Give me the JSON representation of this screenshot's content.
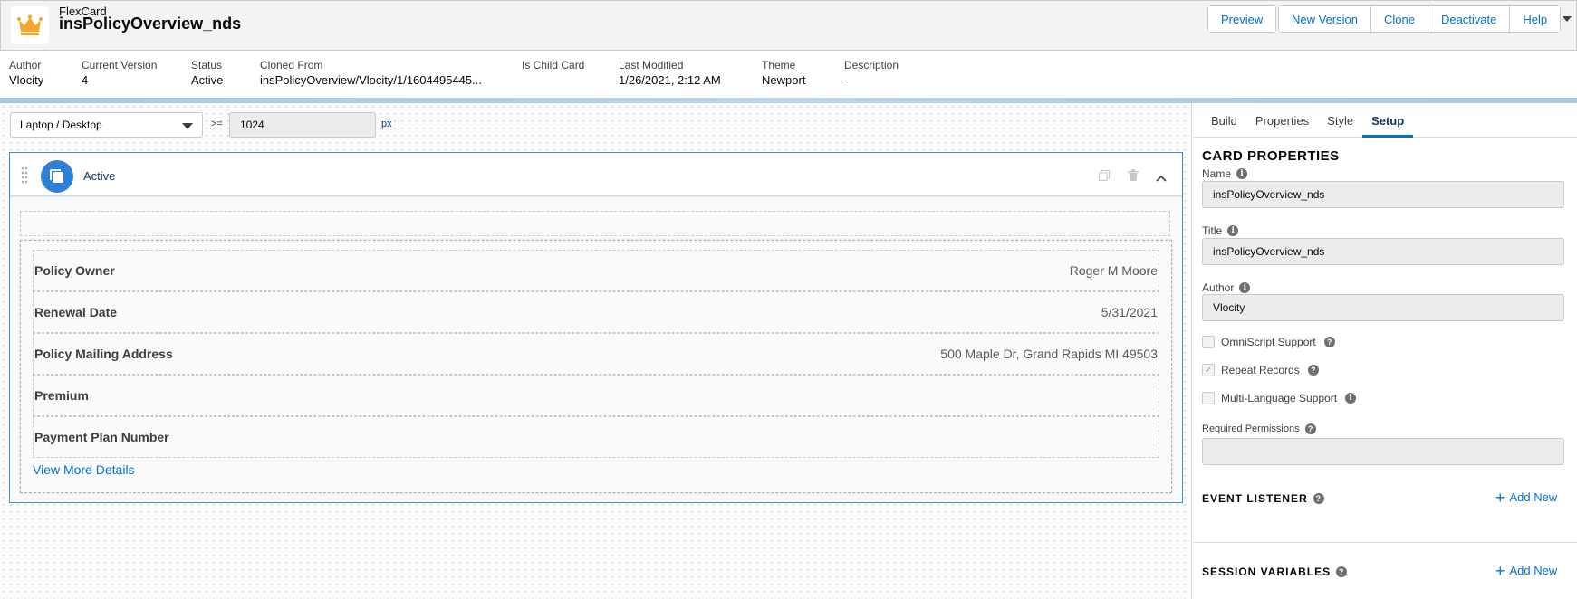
{
  "header": {
    "subtitle": "FlexCard",
    "title": "insPolicyOverview_nds",
    "buttons": [
      "Preview",
      "New Version",
      "Clone",
      "Deactivate",
      "Help"
    ]
  },
  "meta": [
    {
      "label": "Author",
      "value": "Vlocity"
    },
    {
      "label": "Current Version",
      "value": "4"
    },
    {
      "label": "Status",
      "value": "Active"
    },
    {
      "label": "Cloned From",
      "value": "insPolicyOverview/Vlocity/1/1604495445..."
    },
    {
      "label": "Is Child Card",
      "value": ""
    },
    {
      "label": "Last Modified",
      "value": "1/26/2021, 2:12 AM"
    },
    {
      "label": "Theme",
      "value": "Newport"
    },
    {
      "label": "Description",
      "value": "-"
    }
  ],
  "canvas": {
    "device": "Laptop / Desktop",
    "gte": ">=",
    "width_value": "1024",
    "unit": "px",
    "state_label": "Active",
    "fields": [
      {
        "label": "Policy Owner",
        "value": "Roger M Moore"
      },
      {
        "label": "Renewal Date",
        "value": "5/31/2021"
      },
      {
        "label": "Policy Mailing Address",
        "value": "500 Maple Dr, Grand Rapids MI 49503"
      },
      {
        "label": "Premium",
        "value": ""
      },
      {
        "label": "Payment Plan Number",
        "value": ""
      }
    ],
    "view_more": "View More Details"
  },
  "panel": {
    "tabs": [
      "Build",
      "Properties",
      "Style",
      "Setup"
    ],
    "active_tab": "Setup",
    "section_title": "CARD PROPERTIES",
    "name_label": "Name",
    "name_value": "insPolicyOverview_nds",
    "title_label": "Title",
    "title_value": "insPolicyOverview_nds",
    "author_label": "Author",
    "author_value": "Vlocity",
    "omniscript_label": "OmniScript Support",
    "repeat_label": "Repeat Records",
    "multilang_label": "Multi-Language Support",
    "permissions_label": "Required Permissions",
    "permissions_value": "",
    "event_listener": "EVENT LISTENER",
    "session_variables": "SESSION VARIABLES",
    "add_new": "Add New"
  },
  "colors": {
    "brand_blue": "#0070d2",
    "logo_gold": "#f4a62a",
    "state_icon": "#2e7fd6",
    "card_border": "#3d8fd9"
  }
}
